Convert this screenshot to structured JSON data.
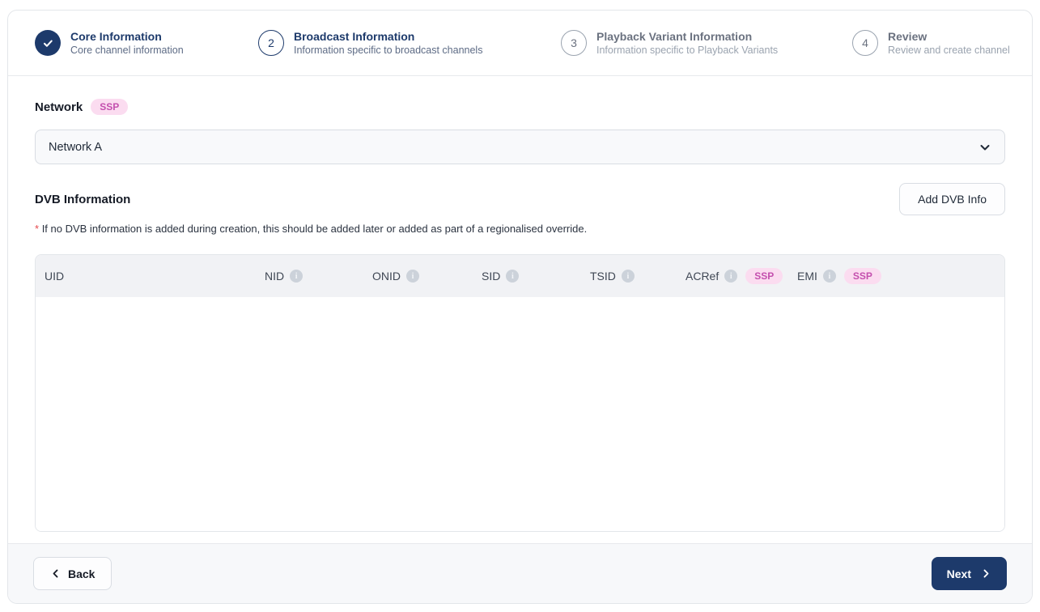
{
  "stepper": {
    "steps": [
      {
        "number": "1",
        "title": "Core Information",
        "subtitle": "Core channel information",
        "state": "complete"
      },
      {
        "number": "2",
        "title": "Broadcast Information",
        "subtitle": "Information specific to broadcast channels",
        "state": "active"
      },
      {
        "number": "3",
        "title": "Playback Variant Information",
        "subtitle": "Information specific to Playback Variants",
        "state": "inactive"
      },
      {
        "number": "4",
        "title": "Review",
        "subtitle": "Review and create channel",
        "state": "inactive"
      }
    ]
  },
  "network": {
    "label": "Network",
    "badge": "SSP",
    "selected_value": "Network A"
  },
  "dvb": {
    "heading": "DVB Information",
    "add_button_label": "Add DVB Info",
    "note_asterisk": "*",
    "note_text": "If no DVB information is added during creation, this should be added later or added as part of a regionalised override.",
    "table": {
      "columns": [
        {
          "label": "UID"
        },
        {
          "label": "NID"
        },
        {
          "label": "ONID"
        },
        {
          "label": "SID"
        },
        {
          "label": "TSID"
        },
        {
          "label": "ACRef",
          "badge": "SSP"
        },
        {
          "label": "EMI",
          "badge": "SSP"
        }
      ],
      "rows": []
    }
  },
  "footer": {
    "back_label": "Back",
    "next_label": "Next"
  },
  "icons": {
    "step_complete": "check-icon",
    "select": "chevron-down-icon",
    "column_info": "info-icon",
    "back": "chevron-left-icon",
    "next": "chevron-right-icon"
  },
  "colors": {
    "primary_navy": "#1d3a6b",
    "ssp_badge_bg": "#fbdcf0",
    "ssp_badge_text": "#c44fae",
    "note_asterisk_red": "#e5484d",
    "table_header_bg": "#f1f2f5",
    "footer_bg": "#f7f8fa",
    "border": "#e3e6ea"
  }
}
